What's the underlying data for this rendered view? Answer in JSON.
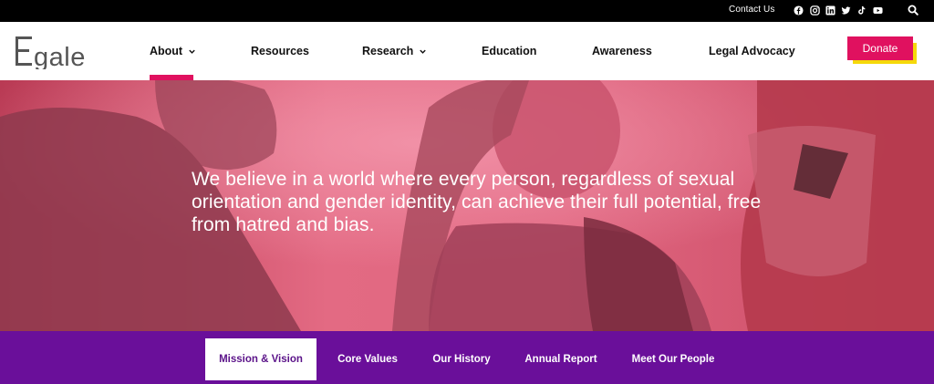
{
  "topbar": {
    "contact_label": "Contact Us",
    "social_icons": [
      "facebook-icon",
      "instagram-icon",
      "linkedin-icon",
      "twitter-icon",
      "tiktok-icon",
      "youtube-icon"
    ],
    "search_icon": "search-icon"
  },
  "header": {
    "logo_text": "Egale",
    "nav": [
      {
        "label": "About",
        "has_dropdown": true,
        "active": true
      },
      {
        "label": "Resources",
        "has_dropdown": false
      },
      {
        "label": "Research",
        "has_dropdown": true
      },
      {
        "label": "Education",
        "has_dropdown": false
      },
      {
        "label": "Awareness",
        "has_dropdown": false
      },
      {
        "label": "Legal Advocacy",
        "has_dropdown": false
      }
    ],
    "donate_label": "Donate"
  },
  "hero": {
    "statement": "We believe in a world where every person, regardless of sexual orientation and gender identity, can achieve their full potential, free from hatred and bias."
  },
  "subnav": {
    "items": [
      {
        "label": "Mission & Vision",
        "active": true
      },
      {
        "label": "Core Values"
      },
      {
        "label": "Our History"
      },
      {
        "label": "Annual Report"
      },
      {
        "label": "Meet Our People"
      }
    ]
  },
  "colors": {
    "accent_pink": "#e0115f",
    "accent_yellow": "#f5d90a",
    "subnav_purple": "#6a0f9a",
    "topbar_black": "#000000"
  }
}
